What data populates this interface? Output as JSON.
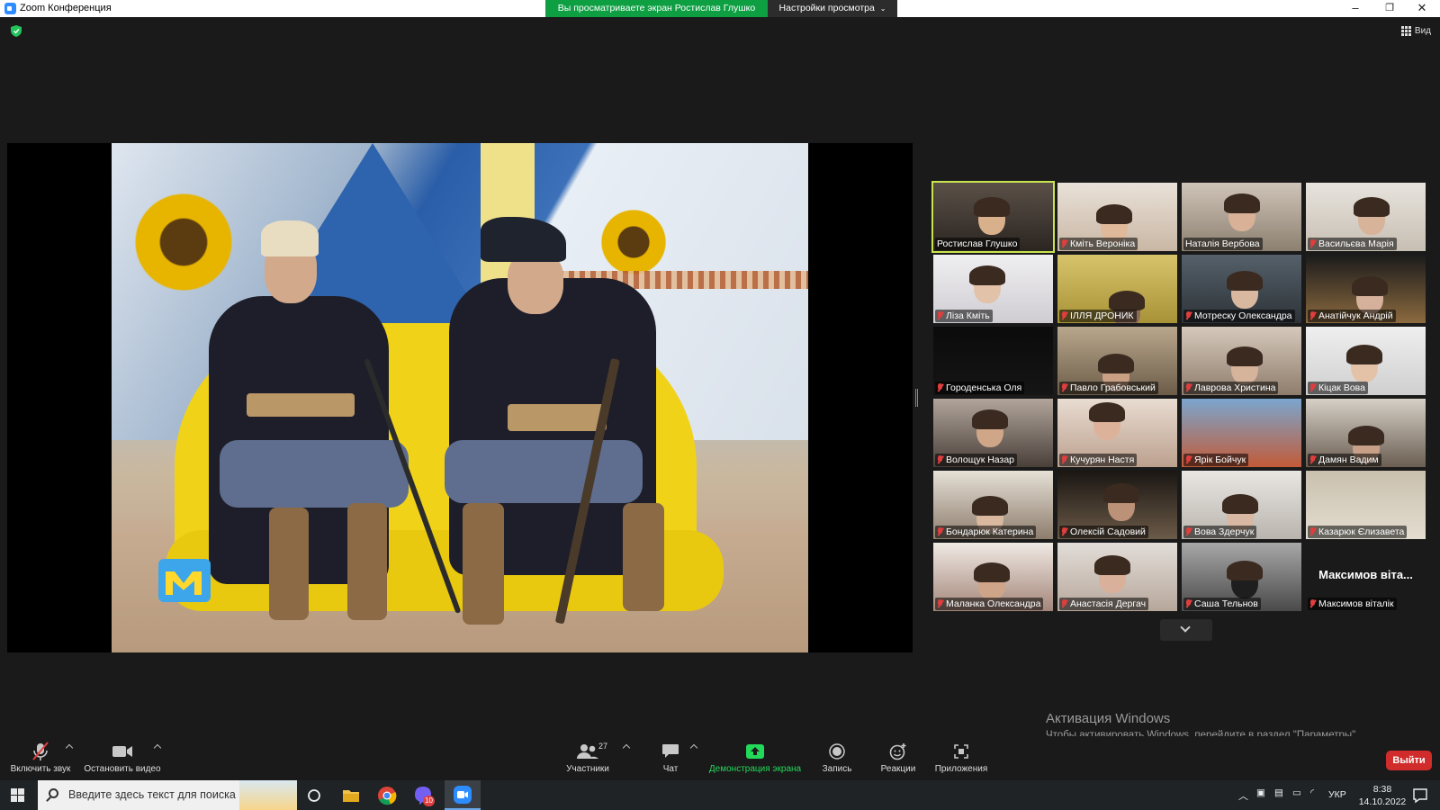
{
  "window": {
    "title": "Zoom Конференция",
    "share_banner": "Вы просматриваете экран Ростислав Глушко",
    "view_options": "Настройки просмотра",
    "view_button": "Вид"
  },
  "participants": [
    {
      "name": "Ростислав Глушко",
      "muted": false,
      "active": true
    },
    {
      "name": "Кміть Вероніка",
      "muted": true
    },
    {
      "name": "Наталія Вербова",
      "muted": false
    },
    {
      "name": "Васильєва Марія",
      "muted": true
    },
    {
      "name": "Ліза Кміть",
      "muted": true
    },
    {
      "name": "ІЛЛЯ ДРОНИК",
      "muted": true
    },
    {
      "name": "Мотреску Олександра",
      "muted": true
    },
    {
      "name": "Анатійчук Андрій",
      "muted": true
    },
    {
      "name": "Городенська Оля",
      "muted": true
    },
    {
      "name": "Павло Грабовський",
      "muted": true
    },
    {
      "name": "Лаврова Христина",
      "muted": true
    },
    {
      "name": "Кіцак Вова",
      "muted": true
    },
    {
      "name": "Волощук Назар",
      "muted": true
    },
    {
      "name": "Кучурян Настя",
      "muted": true
    },
    {
      "name": "Ярік Бойчук",
      "muted": true
    },
    {
      "name": "Дамян Вадим",
      "muted": true
    },
    {
      "name": "Бондарюк Катерина",
      "muted": true
    },
    {
      "name": "Олексій Садовий",
      "muted": true
    },
    {
      "name": "Вова Здерчук",
      "muted": true
    },
    {
      "name": "Казарюк Єлизавета",
      "muted": true
    },
    {
      "name": "Маланка Олександра",
      "muted": true
    },
    {
      "name": "Анастасія Дергач",
      "muted": true
    },
    {
      "name": "Саша Тельнов",
      "muted": true
    },
    {
      "name": "Максимов віталік",
      "muted": true,
      "no_video_label": "Максимов віта..."
    }
  ],
  "activation": {
    "title": "Активация Windows",
    "subtitle": "Чтобы активировать Windows, перейдите в раздел \"Параметры\"."
  },
  "toolbar": {
    "unmute": "Включить звук",
    "stop_video": "Остановить видео",
    "participants": "Участники",
    "participants_count": "27",
    "chat": "Чат",
    "share_screen": "Демонстрация экрана",
    "record": "Запись",
    "reactions": "Реакции",
    "apps": "Приложения",
    "leave": "Выйти"
  },
  "taskbar": {
    "search_placeholder": "Введите здесь текст для поиска",
    "viber_badge": "10",
    "language": "УКР",
    "time": "8:38",
    "date": "14.10.2022"
  },
  "colors": {
    "share_green": "#0e9f43",
    "active_speaker": "#c8e44e",
    "leave_red": "#d12c2c",
    "muted_red": "#e03e3e"
  }
}
